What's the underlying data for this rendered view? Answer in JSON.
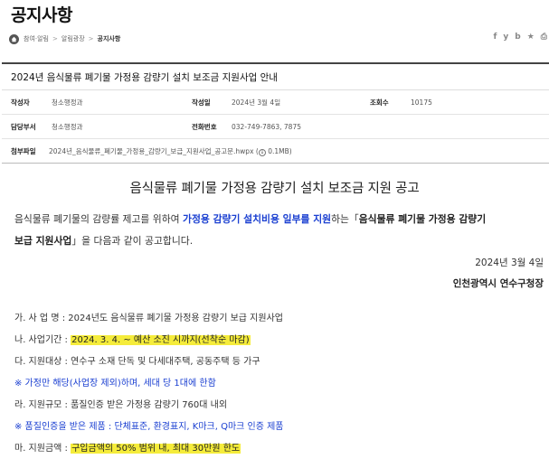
{
  "page": {
    "title": "공지사항"
  },
  "breadcrumb": {
    "items": [
      "참여·알림",
      "알림광장",
      "공지사항"
    ],
    "separator": ">"
  },
  "share": [
    "f",
    "y",
    "b",
    "★",
    "⎙"
  ],
  "notice": {
    "title": "2024년 음식물류 폐기물 가정용 감량기 설치 보조금 지원사업 안내",
    "author_label": "작성자",
    "author": "청소행정과",
    "date_label": "작성일",
    "date": "2024년 3월 4일",
    "views_label": "조회수",
    "views": "10175",
    "dept_label": "담당부서",
    "dept": "청소행정과",
    "phone_label": "전화번호",
    "phone": "032-749-7863, 7875",
    "file_label": "첨부파일",
    "file": "2024년_음식물류_폐기물_가정용_감량기_보급_지원사업_공고문.hwpx",
    "file_size": "0.1MB"
  },
  "body": {
    "heading": "음식물류 폐기물 가정용 감량기 설치 보조금 지원 공고",
    "intro_1": "음식물류 폐기물의 감량률 제고를 위하여 ",
    "intro_blue": "가정용 감량기 설치비용 일부를 지원",
    "intro_2": "하는「",
    "intro_bold": "음식물류 폐기물 가정용 감량기",
    "intro_bold2": "보급 지원사업",
    "intro_3": "」을 다음과 같이 공고합니다.",
    "date": "2024년 3월 4일",
    "org": "인천광역시 연수구청장",
    "items": {
      "a": "가. 사 업 명 : 2024년도 음식물류 폐기물 가정용 감량기 보급 지원사업",
      "b_label": "나. 사업기간 : ",
      "b_value": "2024. 3. 4. ~ 예산 소진 시까지(선착순 마감)",
      "c": "다. 지원대상 : 연수구 소재 단독 및 다세대주택, 공동주택 등 가구",
      "note1": "※ 가정만 해당(사업장 제외)하며, 세대 당 1대에 한함",
      "d": "라. 지원규모 : 품질인증 받은 가정용 감량기 760대 내외",
      "note2": "※ 품질인증을 받은 제품 : 단체표준, 환경표지, K마크, Q마크 인증 제품",
      "e_label": "마. 지원금액 : ",
      "e_value": "구입금액의 50% 범위 내, 최대 30만원 한도"
    }
  }
}
